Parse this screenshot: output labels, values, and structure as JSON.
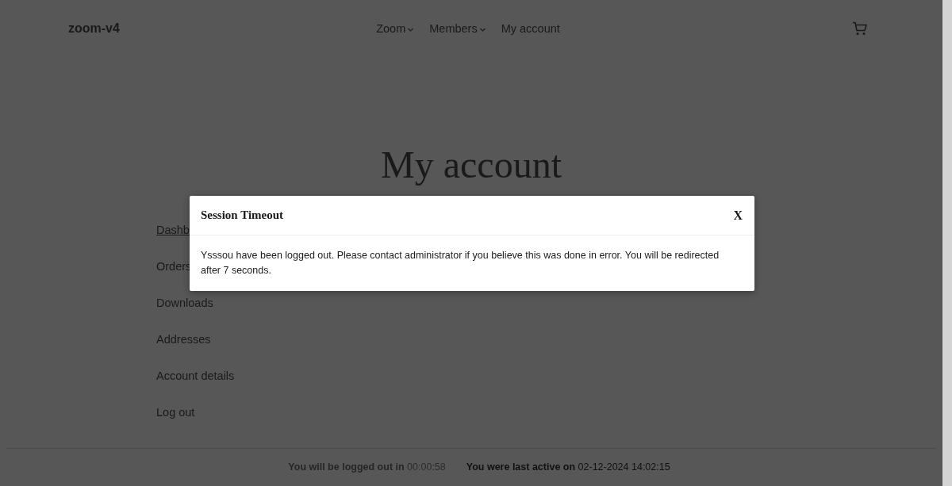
{
  "site": {
    "title": "zoom-v4"
  },
  "nav": [
    {
      "label": "Zoom",
      "dropdown": true
    },
    {
      "label": "Members",
      "dropdown": true
    },
    {
      "label": "My account",
      "dropdown": false
    }
  ],
  "page_title": "My account",
  "account_menu": [
    {
      "label": "Dashb",
      "selected": true
    },
    {
      "label": "Orders",
      "selected": false
    },
    {
      "label": "Downloads",
      "selected": false
    },
    {
      "label": "Addresses",
      "selected": false
    },
    {
      "label": "Account details",
      "selected": false
    },
    {
      "label": "Log out",
      "selected": false
    }
  ],
  "dialog": {
    "title": "Session Timeout",
    "close": "X",
    "message": "Ysssou have been logged out. Please contact administrator if you believe this was done in error. You will be redirected after 7 seconds."
  },
  "status_bar": [
    {
      "label": "You will be logged out in",
      "value": "00:00:58",
      "dimmed": true
    },
    {
      "label": "You were last active on",
      "value": "02-12-2024 14:02:15",
      "dimmed": false
    }
  ]
}
